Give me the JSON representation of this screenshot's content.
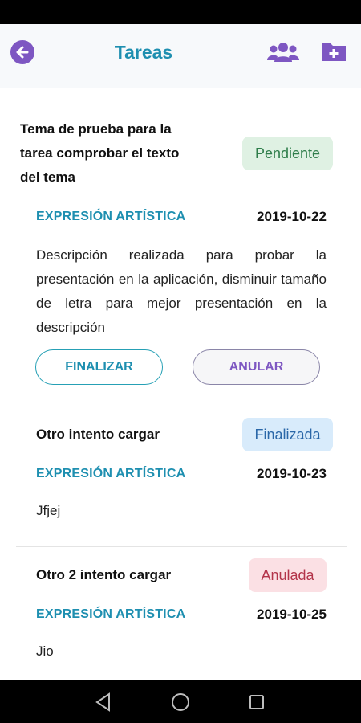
{
  "header": {
    "title": "Tareas",
    "icons": [
      "arrow-left-icon",
      "users-group-icon",
      "folder-plus-icon"
    ]
  },
  "tasks": [
    {
      "title_lines": [
        "Tema de prueba para la",
        "tarea comprobar el texto",
        "del tema"
      ],
      "status": "Pendiente",
      "category": "EXPRESIÓN ARTÍSTICA",
      "date": "2019-10-22",
      "description": "Descripción realizada para probar la presentación en la aplicación, disminuir tamaño de letra para mejor presentación en la descripción",
      "actions": {
        "finish": "FINALIZAR",
        "cancel": "ANULAR"
      }
    },
    {
      "title": "Otro intento cargar",
      "status": "Finalizada",
      "category": "EXPRESIÓN ARTÍSTICA",
      "date": "2019-10-23",
      "description": "Jfjej"
    },
    {
      "title": "Otro 2 intento cargar",
      "status": "Anulada",
      "category": "EXPRESIÓN ARTÍSTICA",
      "date": "2019-10-25",
      "description": "Jio"
    }
  ],
  "colors": {
    "accent": "#1e8fb0",
    "purple": "#7e57c2",
    "pending": "#dff1e3",
    "finished": "#d8ebfb",
    "cancelled": "#fbe0e4"
  },
  "system_nav": [
    "back-triangle-icon",
    "home-circle-icon",
    "recents-square-icon"
  ]
}
